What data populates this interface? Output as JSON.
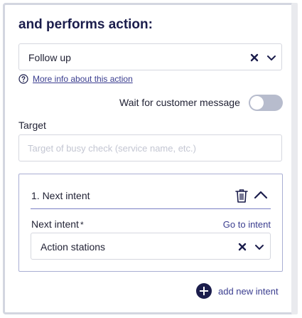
{
  "heading": "and performs action:",
  "action_select": {
    "value": "Follow up",
    "clear_icon": "close-icon",
    "toggle_icon": "chevron-down-icon"
  },
  "info_link": {
    "icon": "question-circle-icon",
    "label": "More info about this action"
  },
  "wait_toggle": {
    "label": "Wait for customer message",
    "on": false
  },
  "target": {
    "label": "Target",
    "placeholder": "Target of busy check (service name, etc.)",
    "value": ""
  },
  "intent_card": {
    "title": "1. Next intent",
    "delete_icon": "trash-icon",
    "collapse_icon": "chevron-up-icon",
    "field_label": "Next intent",
    "required_mark": "*",
    "goto_label": "Go to intent",
    "select_value": "Action stations"
  },
  "add_intent": {
    "icon": "plus-circle-icon",
    "label": "add new intent"
  },
  "colors": {
    "heading": "#1b1d4c",
    "link": "#3a3d8f",
    "border": "#d5d7df",
    "card_border": "#a9aed3",
    "toggle_off": "#b7bccd"
  }
}
